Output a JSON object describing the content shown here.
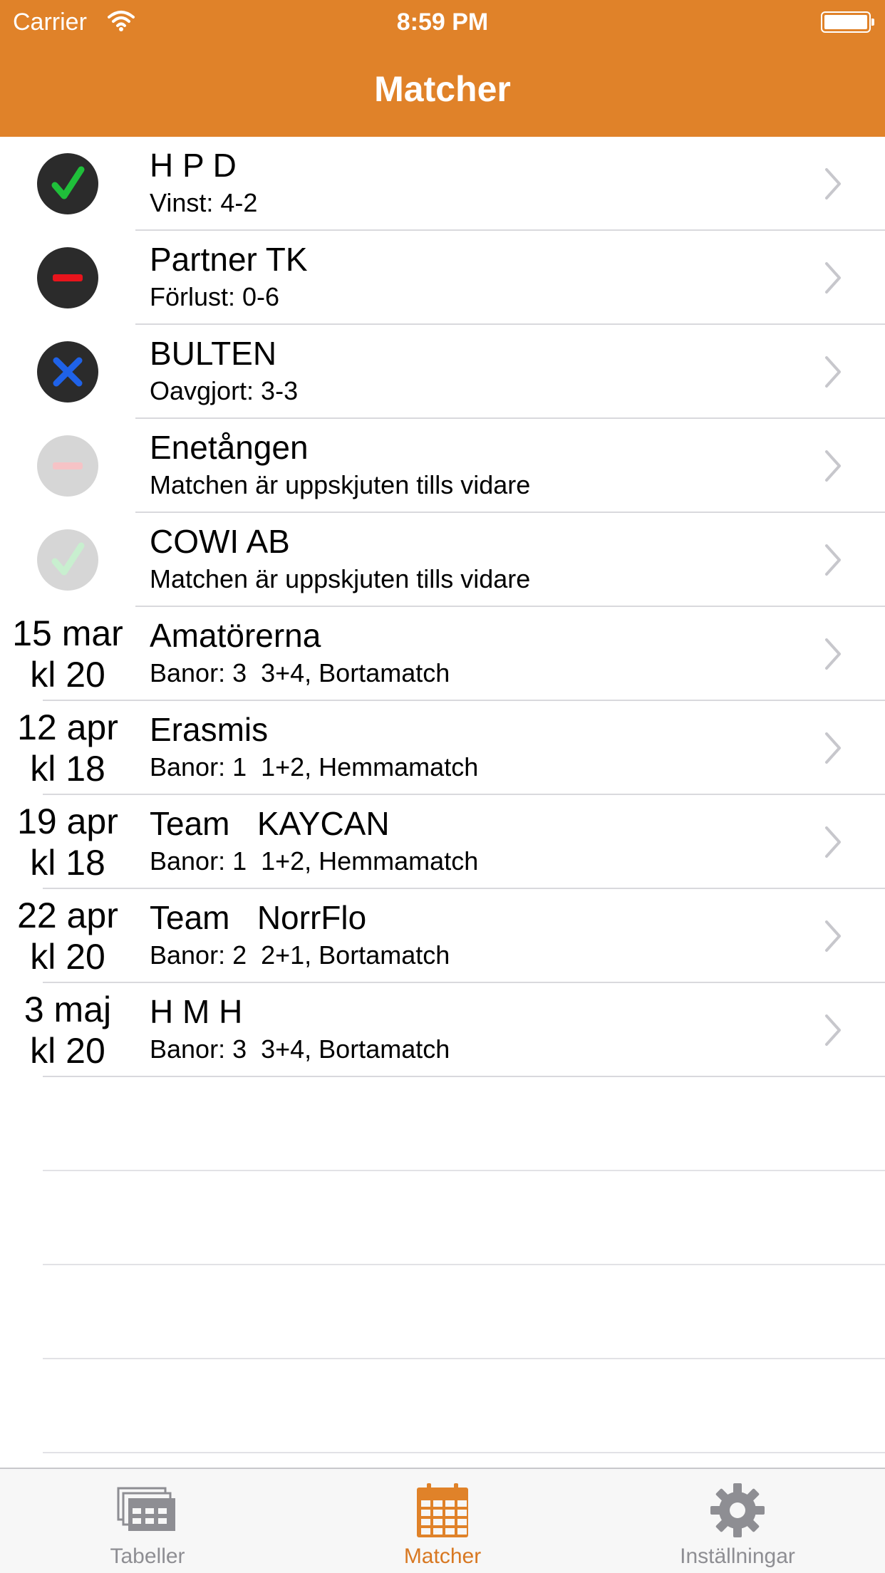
{
  "status_bar": {
    "carrier": "Carrier",
    "time": "8:59 PM"
  },
  "nav": {
    "title": "Matcher"
  },
  "colors": {
    "accent": "#e08229",
    "win": "#1fbf3a",
    "loss": "#e8141c",
    "draw": "#1f62e8"
  },
  "matches": [
    {
      "lead_type": "icon",
      "icon": "check-icon",
      "faded": false,
      "title": "H P D",
      "subtitle": "Vinst: 4-2"
    },
    {
      "lead_type": "icon",
      "icon": "minus-icon",
      "faded": false,
      "title": "Partner TK",
      "subtitle": "Förlust: 0-6"
    },
    {
      "lead_type": "icon",
      "icon": "cross-icon",
      "faded": false,
      "title": "BULTEN",
      "subtitle": "Oavgjort: 3-3"
    },
    {
      "lead_type": "icon",
      "icon": "minus-icon",
      "faded": true,
      "title": "Enetången",
      "subtitle": "Matchen är uppskjuten tills vidare"
    },
    {
      "lead_type": "icon",
      "icon": "check-icon",
      "faded": true,
      "title": "COWI AB",
      "subtitle": "Matchen är uppskjuten tills vidare"
    },
    {
      "lead_type": "date",
      "date": "15 mar",
      "time": "kl 20",
      "title": "Amatörerna",
      "subtitle": "Banor: 3  3+4, Bortamatch"
    },
    {
      "lead_type": "date",
      "date": "12 apr",
      "time": "kl 18",
      "title": "Erasmis",
      "subtitle": "Banor: 1  1+2, Hemmamatch"
    },
    {
      "lead_type": "date",
      "date": "19 apr",
      "time": "kl 18",
      "title": "Team   KAYCAN",
      "subtitle": "Banor: 1  1+2, Hemmamatch"
    },
    {
      "lead_type": "date",
      "date": "22 apr",
      "time": "kl 20",
      "title": "Team   NorrFlo",
      "subtitle": "Banor: 2  2+1, Bortamatch"
    },
    {
      "lead_type": "date",
      "date": "3 maj",
      "time": "kl 20",
      "title": "H M H",
      "subtitle": "Banor: 3  3+4, Bortamatch"
    }
  ],
  "tabs": [
    {
      "label": "Tabeller",
      "icon": "tables-icon",
      "active": false
    },
    {
      "label": "Matcher",
      "icon": "calendar-icon",
      "active": true
    },
    {
      "label": "Inställningar",
      "icon": "gear-icon",
      "active": false
    }
  ]
}
